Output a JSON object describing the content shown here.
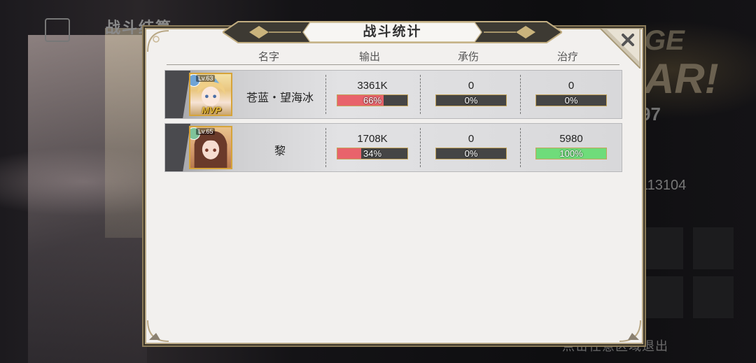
{
  "background": {
    "title": "战斗结算",
    "stage_text": "GE",
    "clear_text": "AR!",
    "number": "97",
    "id_text": "113104",
    "hint": "点击任意区域退出"
  },
  "dialog": {
    "title": "战斗统计",
    "close_label": "×",
    "headers": {
      "name": "名字",
      "output": "输出",
      "tank": "承伤",
      "heal": "治疗"
    }
  },
  "rows": [
    {
      "name": "苍蓝・望海冰",
      "level": "Lv.63",
      "mvp": "MVP",
      "output": {
        "value": "3361K",
        "pct": "66%",
        "fraction": 0.66
      },
      "tank": {
        "value": "0",
        "pct": "0%",
        "fraction": 0
      },
      "heal": {
        "value": "0",
        "pct": "0%",
        "fraction": 0
      }
    },
    {
      "name": "黎",
      "level": "Lv.65",
      "output": {
        "value": "1708K",
        "pct": "34%",
        "fraction": 0.34
      },
      "tank": {
        "value": "0",
        "pct": "0%",
        "fraction": 0
      },
      "heal": {
        "value": "5980",
        "pct": "100%",
        "fraction": 1
      }
    }
  ],
  "colors": {
    "output_bar": "#e8636b",
    "tank_bar": "#6aaee0",
    "heal_bar": "#6fdc7a",
    "frame_gold": "#b9a886"
  }
}
